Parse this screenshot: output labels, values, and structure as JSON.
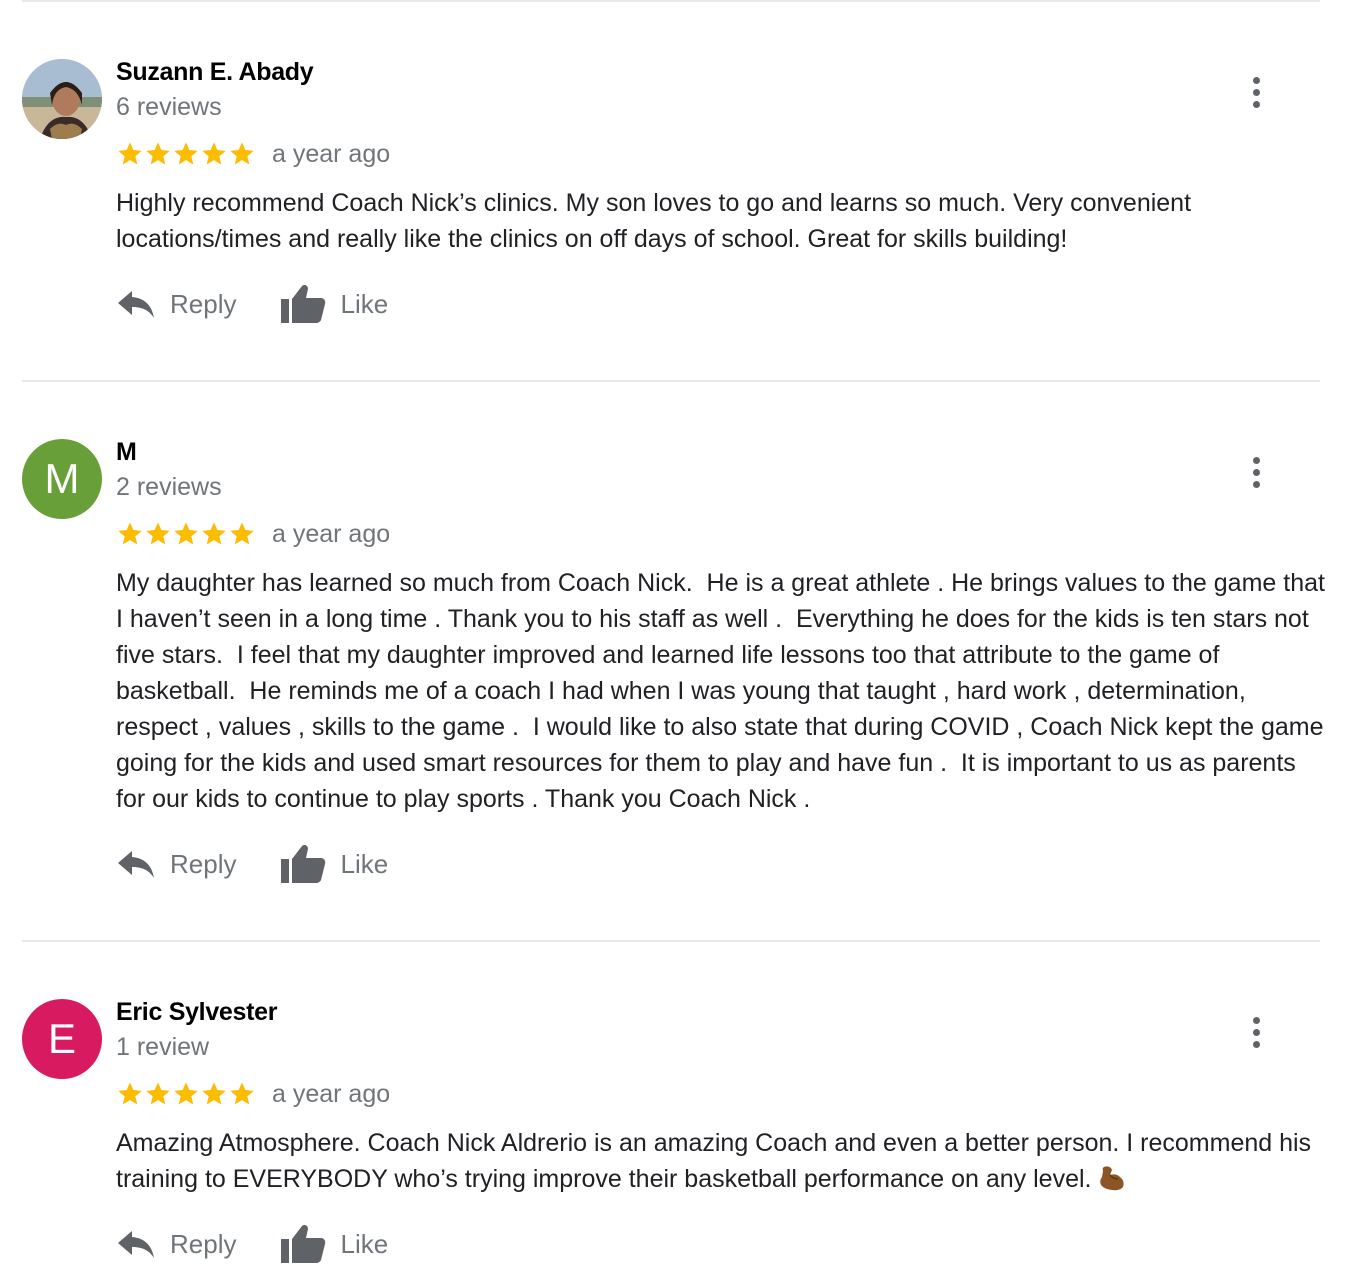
{
  "colors": {
    "star": "#fbbc04",
    "icon_gray": "#5f6368",
    "text_gray": "#70757a",
    "avatar_m": "#689f38",
    "avatar_e": "#d81b60"
  },
  "reviews": [
    {
      "name": "Suzann E. Abady",
      "count": "6 reviews",
      "rating": 5,
      "date": "a year ago",
      "text": "Highly recommend Coach Nick’s clinics. My son loves to go and learns so much. Very convenient locations/times and really like the clinics on off days of school. Great for skills building!",
      "reply": "Reply",
      "like": "Like"
    },
    {
      "name": "M",
      "initial": "M",
      "count": "2 reviews",
      "rating": 5,
      "date": "a year ago",
      "text": "My daughter has learned so much from Coach Nick.  He is a great athlete . He brings values to the game that I haven’t seen in a long time . Thank you to his staff as well .  Everything he does for the kids is ten stars not five stars.  I feel that my daughter improved and learned life lessons too that attribute to the game of basketball.  He reminds me of a coach I had when I was young that taught , hard work , determination, respect , values , skills to the game .  I would like to also state that during COVID , Coach Nick kept the game going for the kids and used smart resources for them to play and have fun .  It is important to us as parents for our kids to continue to play sports . Thank you Coach Nick .",
      "reply": "Reply",
      "like": "Like"
    },
    {
      "name": "Eric Sylvester",
      "initial": "E",
      "count": "1 review",
      "rating": 5,
      "date": "a year ago",
      "text": "Amazing Atmosphere. Coach Nick Aldrerio is an amazing Coach and even a better person. I recommend his training to EVERYBODY who’s trying improve their basketball performance on any level. ",
      "reply": "Reply",
      "like": "Like"
    }
  ]
}
